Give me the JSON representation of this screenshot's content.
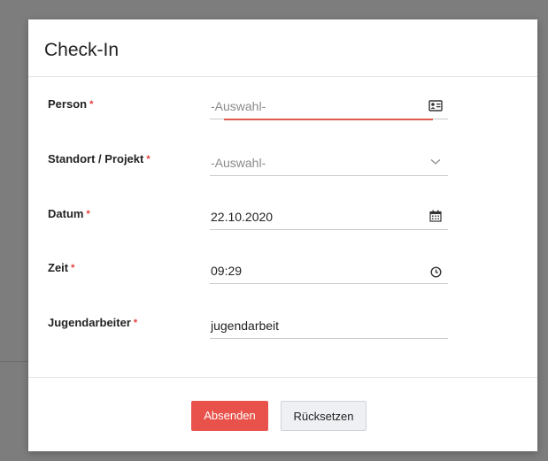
{
  "dialog": {
    "title": "Check-In"
  },
  "form": {
    "required_marker": "*",
    "person": {
      "label": "Person",
      "value": "-Auswahl-",
      "icon": "contact-card-icon"
    },
    "standort": {
      "label": "Standort / Projekt",
      "value": "-Auswahl-",
      "icon": "chevron-down-icon"
    },
    "datum": {
      "label": "Datum",
      "value": "22.10.2020",
      "icon": "calendar-icon"
    },
    "zeit": {
      "label": "Zeit",
      "value": "09:29",
      "icon": "clock-icon"
    },
    "jugendarbeiter": {
      "label": "Jugendarbeiter",
      "value": "jugendarbeit"
    }
  },
  "footer": {
    "submit_label": "Absenden",
    "reset_label": "Rücksetzen"
  },
  "colors": {
    "accent": "#e8524a",
    "required": "#e53935",
    "focus_underline": "#e05a4e",
    "backdrop": "#7d7d7d"
  }
}
